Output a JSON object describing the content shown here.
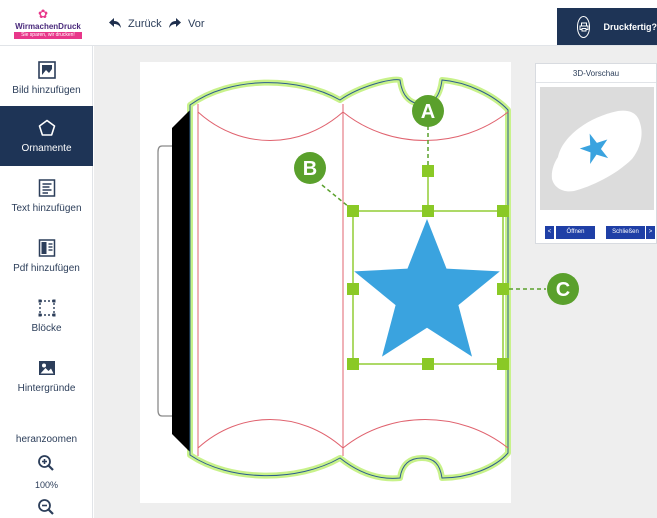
{
  "header": {
    "logo_text": "WirmachenDruck",
    "logo_tagline": "Sie sparen, wir drucken!",
    "nav_back_label": "Zurück",
    "nav_forward_label": "Vor",
    "print_ready_label": "Druckfertig?"
  },
  "sidebar": {
    "items": [
      {
        "label": "Bild hinzufügen",
        "icon": "image-icon",
        "active": false
      },
      {
        "label": "Ornamente",
        "icon": "pentagon-icon",
        "active": true
      },
      {
        "label": "Text hinzufügen",
        "icon": "text-icon",
        "active": false
      },
      {
        "label": "Pdf hinzufügen",
        "icon": "pdf-icon",
        "active": false
      },
      {
        "label": "Blöcke",
        "icon": "blocks-icon",
        "active": false
      },
      {
        "label": "Hintergründe",
        "icon": "background-icon",
        "active": false
      }
    ],
    "zoom_label": "heranzoomen",
    "zoom_value": "100%"
  },
  "preview": {
    "title": "3D-Vorschau",
    "open_label": "Öffnen",
    "close_label": "Schließen",
    "prev_label": "<",
    "next_label": ">"
  },
  "annotations": [
    "A",
    "B",
    "C"
  ],
  "colors": {
    "navy": "#1e3456",
    "star": "#3aa3df",
    "selection": "#8ac926",
    "annotation": "#5aa02c",
    "cut_line": "#e0636f",
    "outline": "#c8f28a",
    "preview_button": "#1f3fa6"
  }
}
